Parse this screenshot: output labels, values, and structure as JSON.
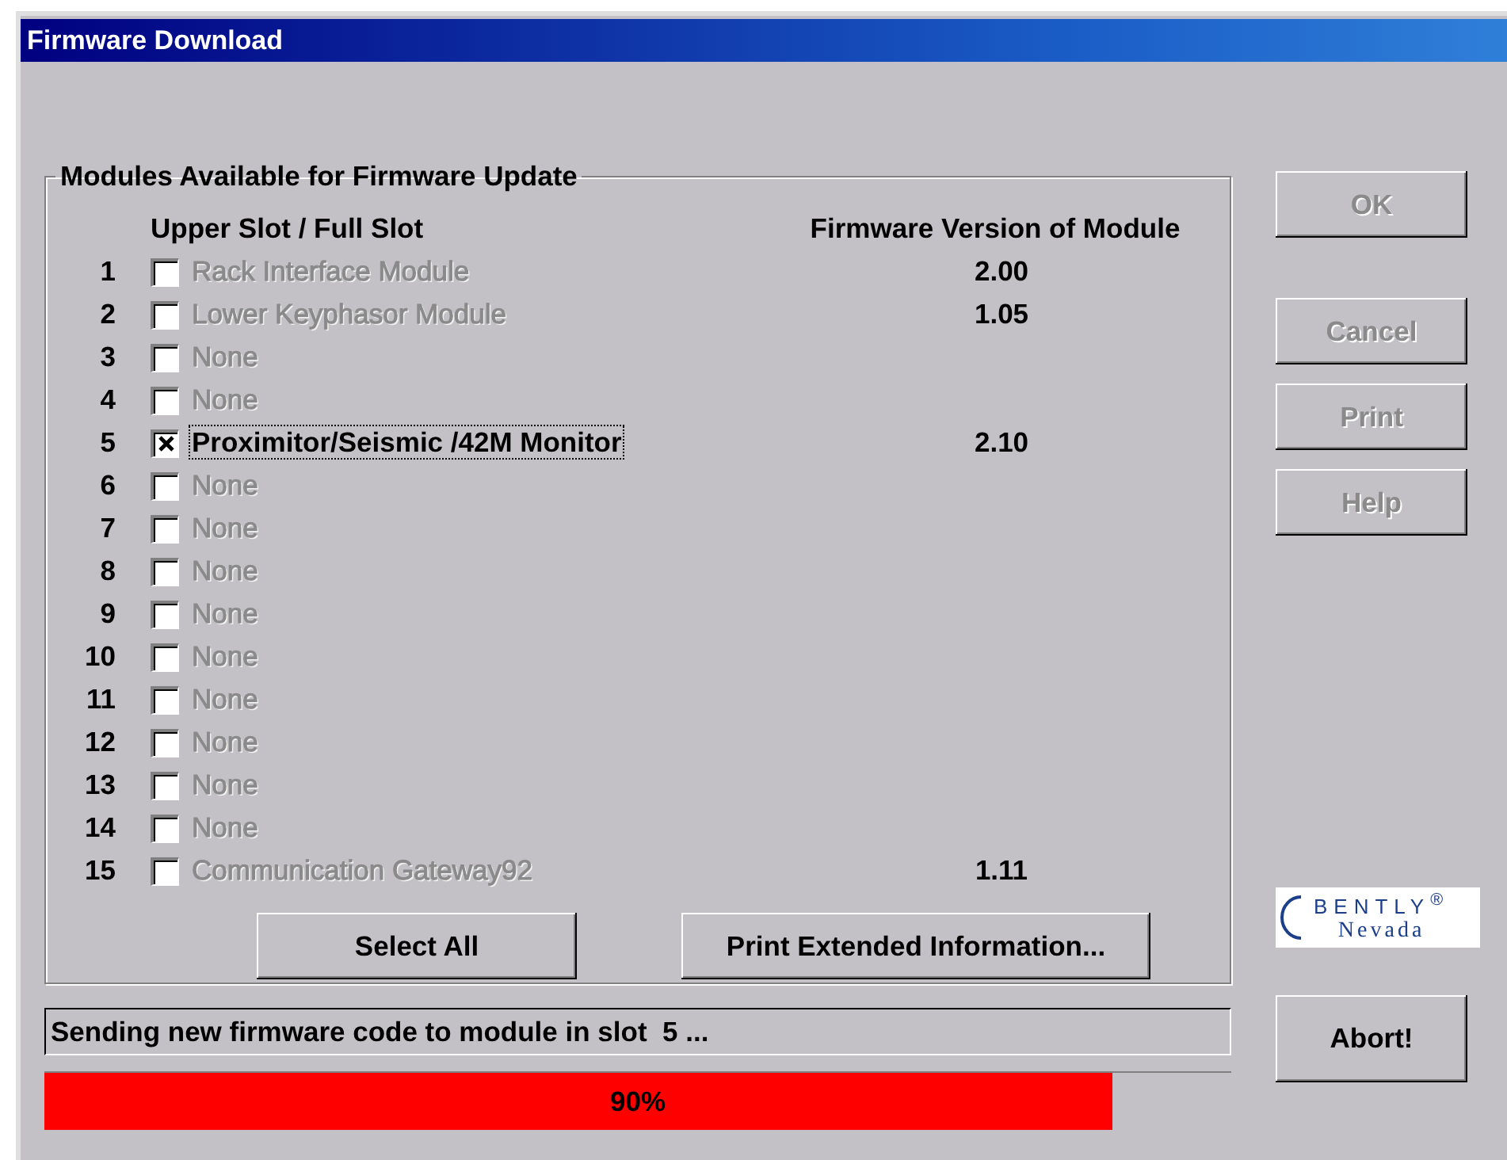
{
  "window": {
    "title": "Firmware Download"
  },
  "group": {
    "title": "Modules Available for Firmware Update",
    "slot_header": "Upper Slot / Full Slot",
    "version_header": "Firmware Version of Module",
    "rows": [
      {
        "slot": "1",
        "name": "Rack Interface Module",
        "version": "2.00",
        "checked": false,
        "disabled": true,
        "focused": false
      },
      {
        "slot": "2",
        "name": "Lower Keyphasor Module",
        "version": "1.05",
        "checked": false,
        "disabled": true,
        "focused": false
      },
      {
        "slot": "3",
        "name": "None",
        "checked": false,
        "disabled": true,
        "focused": false
      },
      {
        "slot": "4",
        "name": "None",
        "checked": false,
        "disabled": true,
        "focused": false
      },
      {
        "slot": "5",
        "name": "Proximitor/Seismic /42M Monitor",
        "version": "2.10",
        "checked": true,
        "disabled": false,
        "focused": true
      },
      {
        "slot": "6",
        "name": "None",
        "checked": false,
        "disabled": true,
        "focused": false
      },
      {
        "slot": "7",
        "name": "None",
        "checked": false,
        "disabled": true,
        "focused": false
      },
      {
        "slot": "8",
        "name": "None",
        "checked": false,
        "disabled": true,
        "focused": false
      },
      {
        "slot": "9",
        "name": "None",
        "checked": false,
        "disabled": true,
        "focused": false
      },
      {
        "slot": "10",
        "name": "None",
        "checked": false,
        "disabled": true,
        "focused": false
      },
      {
        "slot": "11",
        "name": "None",
        "checked": false,
        "disabled": true,
        "focused": false
      },
      {
        "slot": "12",
        "name": "None",
        "checked": false,
        "disabled": true,
        "focused": false
      },
      {
        "slot": "13",
        "name": "None",
        "checked": false,
        "disabled": true,
        "focused": false
      },
      {
        "slot": "14",
        "name": "None",
        "checked": false,
        "disabled": true,
        "focused": false
      },
      {
        "slot": "15",
        "name": "Communication Gateway92",
        "version": "1.11",
        "checked": false,
        "disabled": true,
        "focused": false
      }
    ],
    "buttons": [
      {
        "label": "Select All",
        "disabled": false
      },
      {
        "label": "Print Extended Information...",
        "disabled": false
      }
    ]
  },
  "side_buttons": [
    {
      "label": "OK",
      "disabled": true
    },
    {
      "label": "Cancel",
      "disabled": true
    },
    {
      "label": "Print",
      "disabled": true
    },
    {
      "label": "Help",
      "disabled": true
    }
  ],
  "logo": {
    "brand": "BENTLY$^{®}$",
    "sub": "Nevada"
  },
  "status": "Sending new firmware code to module in slot  5 ...",
  "progress": {
    "level": 0.9,
    "reading": "90%"
  },
  "abort_button": {
    "label": "Abort!",
    "disabled": false
  }
}
